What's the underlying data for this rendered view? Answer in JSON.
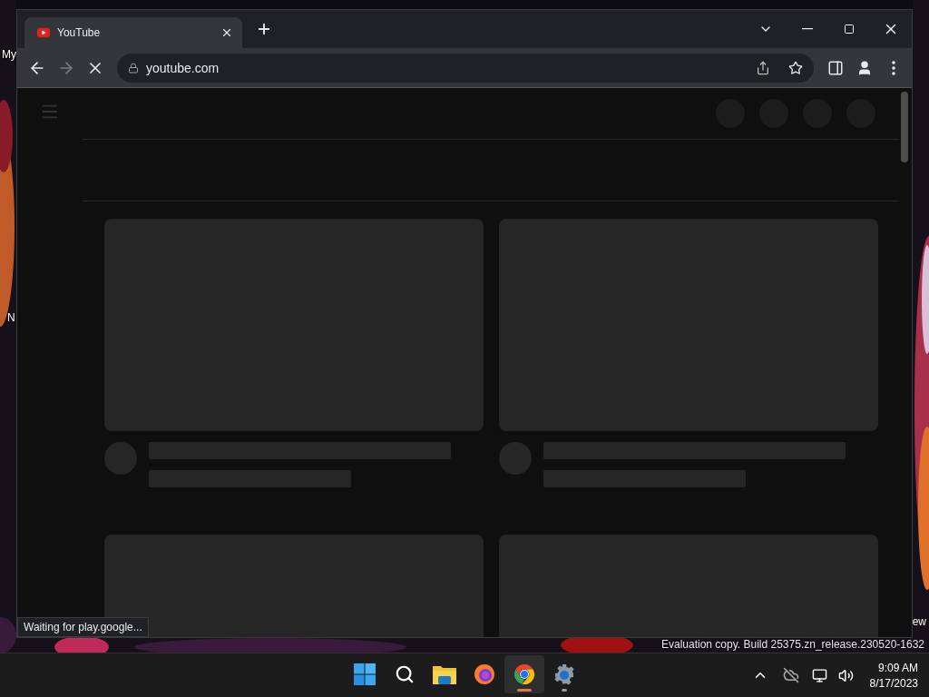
{
  "desktop": {
    "labels": [
      {
        "text": "My"
      },
      {
        "text": "N"
      },
      {
        "text": "ew"
      }
    ],
    "watermark": "Evaluation copy. Build 25375.zn_release.230520-1632"
  },
  "browser": {
    "tabs": [
      {
        "title": "YouTube",
        "selected": true
      }
    ],
    "loading": true,
    "address": "youtube.com",
    "status_text": "Waiting for play.google..."
  },
  "taskbar": {
    "apps": [
      {
        "kind": "start",
        "selected": false,
        "running": false
      },
      {
        "kind": "search",
        "selected": false,
        "running": false
      },
      {
        "kind": "files",
        "selected": false,
        "running": false
      },
      {
        "kind": "firefox",
        "selected": false,
        "running": false
      },
      {
        "kind": "chrome",
        "selected": true,
        "running": true
      },
      {
        "kind": "settings",
        "selected": false,
        "running": true
      }
    ],
    "time": "9:09 AM",
    "date": "8/17/2023"
  }
}
